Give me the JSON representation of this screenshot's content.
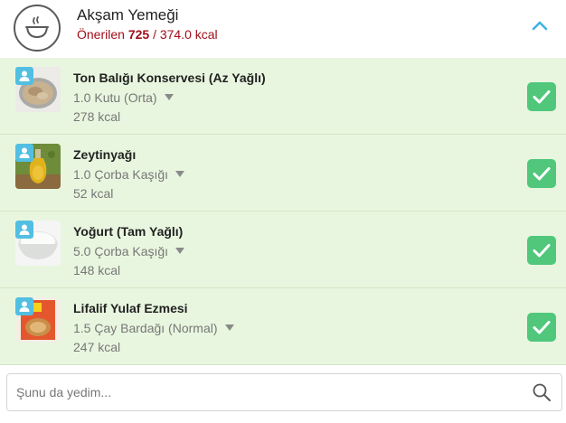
{
  "meal": {
    "title": "Akşam Yemeği",
    "recommended_label": "Önerilen",
    "recommended_value": "725",
    "separator_total": "/ 374.0 kcal",
    "icon": "bowl-icon",
    "collapse_icon": "chevron-up-icon"
  },
  "foods": [
    {
      "name": "Ton Balığı Konservesi (Az Yağlı)",
      "portion": "1.0 Kutu (Orta)",
      "kcal": "278 kcal",
      "thumb": "tuna-can",
      "checked": true
    },
    {
      "name": "Zeytinyağı",
      "portion": "1.0 Çorba Kaşığı",
      "kcal": "52 kcal",
      "thumb": "olive-oil-bottle",
      "checked": true
    },
    {
      "name": "Yoğurt (Tam Yağlı)",
      "portion": "5.0 Çorba Kaşığı",
      "kcal": "148 kcal",
      "thumb": "yogurt-bowl",
      "checked": true
    },
    {
      "name": "Lifalif Yulaf Ezmesi",
      "portion": "1.5 Çay Bardağı (Normal)",
      "kcal": "247 kcal",
      "thumb": "oat-package",
      "checked": true
    }
  ],
  "search": {
    "placeholder": "Şunu da yedim...",
    "value": "",
    "icon": "search-icon"
  },
  "colors": {
    "accent_red": "#a10e19",
    "row_bg": "#e8f6df",
    "check_green": "#50c77b",
    "badge_blue": "#52bfe2",
    "chevron_blue": "#3db4e0"
  }
}
